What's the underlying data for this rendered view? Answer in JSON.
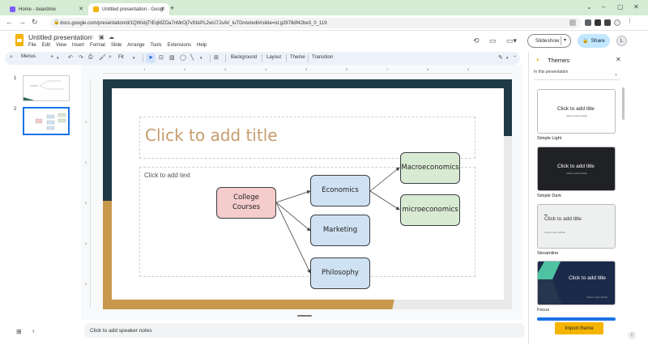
{
  "browser": {
    "tabs": [
      {
        "title": "Home - boardmix",
        "icon_color": "#7b5cff"
      },
      {
        "title": "Untitled presentation - Goog",
        "icon_color": "#f4b400"
      }
    ],
    "new_tab": "+",
    "url": "docs.google.com/presentation/d/1QWsbjTrEqMZOa7nMrOj7v91kPL2wU7JsAV_luTDn/w/edit#slide=id.g2978df42be3_0_119",
    "window_controls": [
      "⌄",
      "–",
      "▢",
      "✕"
    ]
  },
  "app": {
    "title": "Untitled presentation",
    "menu": [
      "File",
      "Edit",
      "View",
      "Insert",
      "Format",
      "Slide",
      "Arrange",
      "Tools",
      "Extensions",
      "Help"
    ],
    "slideshow_label": "Slideshow",
    "share_label": "Share",
    "avatar_initial": "L"
  },
  "toolbar": {
    "menus_label": "Menus",
    "zoom_label": "Fit",
    "background_label": "Background",
    "layout_label": "Layout",
    "theme_label": "Theme",
    "transition_label": "Transition"
  },
  "filmstrip": {
    "slides": [
      {
        "number": "1"
      },
      {
        "number": "2"
      }
    ]
  },
  "slide": {
    "title_placeholder": "Click to add title",
    "body_placeholder": "Click to add text",
    "nodes": {
      "college": "College Courses",
      "economics": "Economics",
      "marketing": "Marketing",
      "philosophy": "Philosophy",
      "macro": "Macroeconomics",
      "micro": "microeconomics"
    },
    "colors": {
      "pink_fill": "#f4cccc",
      "blue_fill": "#cfe2f3",
      "green_fill": "#d9ead3"
    }
  },
  "ruler": {
    "top": [
      "1",
      "2",
      "3",
      "4",
      "5",
      "6",
      "7",
      "8",
      "9"
    ],
    "left": [
      "1",
      "2",
      "3",
      "4",
      "5"
    ]
  },
  "notes": {
    "placeholder": "Click to add speaker notes"
  },
  "themes": {
    "title": "Themes",
    "filter_label": "In this presentation",
    "cards": [
      {
        "name": "Simple Light",
        "title": "Click to add title",
        "subtitle": "Click to add subtitle"
      },
      {
        "name": "Simple Dark",
        "title": "Click to add title",
        "subtitle": "Click to add subtitle"
      },
      {
        "name": "Streamline",
        "title": "Click to add title",
        "subtitle": "Click to add subtitle"
      },
      {
        "name": "Focus",
        "title": "Click to add title",
        "subtitle": "Click to add subtitle"
      }
    ],
    "import_label": "Import theme"
  }
}
